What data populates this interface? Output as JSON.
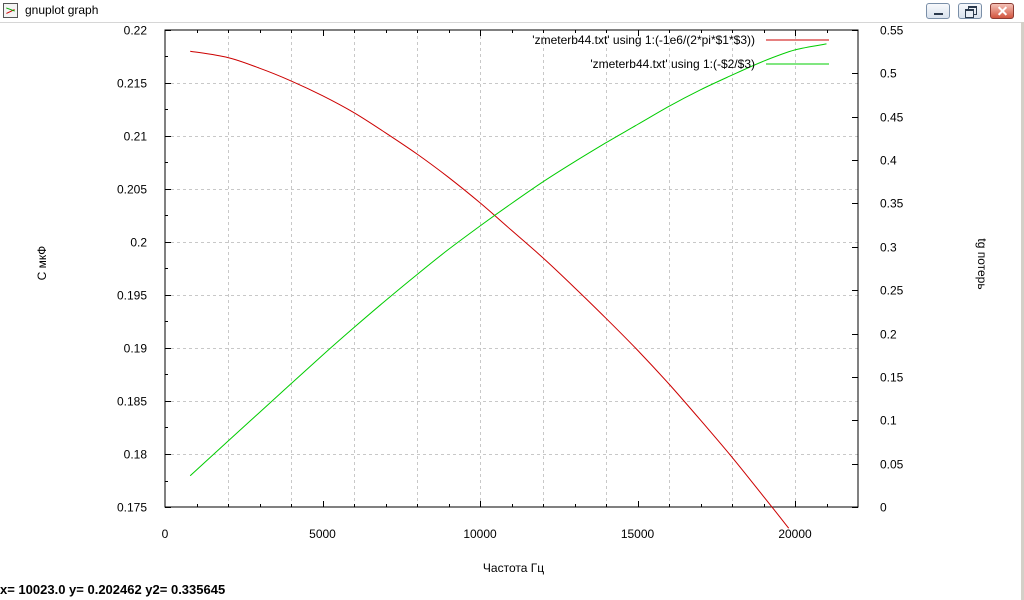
{
  "window": {
    "title": "gnuplot graph",
    "icon": "gnuplot-app-icon",
    "controls": {
      "minimize": "minimize-icon",
      "maximize": "maximize-icon",
      "close": "close-icon"
    }
  },
  "status_text": "x= 10023.0 y= 0.202462 y2= 0.335645",
  "chart_data": {
    "type": "line",
    "title": "",
    "xlabel": "Частота Гц",
    "ylabel": "С мкФ",
    "y2label": "tg потерь",
    "xlim": [
      0,
      22000
    ],
    "ylim": [
      0.175,
      0.22
    ],
    "y2lim": [
      0,
      0.55
    ],
    "grid": true,
    "grid_style": "dashed",
    "legend_position": "top-right",
    "x_ticks": [
      0,
      5000,
      10000,
      15000,
      20000
    ],
    "y_ticks": [
      0.175,
      0.18,
      0.185,
      0.19,
      0.195,
      0.2,
      0.205,
      0.21,
      0.215,
      0.22
    ],
    "y2_ticks": [
      0,
      0.05,
      0.1,
      0.15,
      0.2,
      0.25,
      0.3,
      0.35,
      0.4,
      0.45,
      0.5,
      0.55
    ],
    "x_tick_labels": [
      "0",
      "5000",
      "10000",
      "15000",
      "20000"
    ],
    "y_tick_labels": [
      "0.175",
      "0.18",
      "0.185",
      "0.19",
      "0.195",
      "0.2",
      "0.205",
      "0.21",
      "0.215",
      "0.22"
    ],
    "y2_tick_labels": [
      "0",
      "0.05",
      "0.1",
      "0.15",
      "0.2",
      "0.25",
      "0.3",
      "0.35",
      "0.4",
      "0.45",
      "0.5",
      "0.55"
    ],
    "series": [
      {
        "name": "'zmeterb44.txt' using 1:(-1e6/(2*pi*$1*$3))",
        "axis": "y",
        "color": "#cc0000",
        "x": [
          800,
          2000,
          3000,
          4000,
          5000,
          6000,
          7000,
          8000,
          9000,
          10000,
          11000,
          12000,
          13000,
          14000,
          15000,
          16000,
          17000,
          18000,
          19000,
          19800
        ],
        "y": [
          0.218,
          0.2174,
          0.2164,
          0.2152,
          0.2138,
          0.2122,
          0.2103,
          0.2083,
          0.2061,
          0.2037,
          0.2011,
          0.1985,
          0.1957,
          0.1928,
          0.1898,
          0.1866,
          0.1832,
          0.1797,
          0.176,
          0.173
        ]
      },
      {
        "name": "'zmeterb44.txt' using 1:(-$2/$3)",
        "axis": "y2",
        "color": "#00cc00",
        "x": [
          800,
          2000,
          3000,
          4000,
          5000,
          6000,
          7000,
          8000,
          9000,
          10000,
          11000,
          12000,
          13000,
          14000,
          15000,
          16000,
          17000,
          18000,
          19000,
          20000,
          21000
        ],
        "y": [
          0.036,
          0.076,
          0.109,
          0.142,
          0.175,
          0.207,
          0.238,
          0.268,
          0.297,
          0.324,
          0.35,
          0.375,
          0.398,
          0.42,
          0.441,
          0.462,
          0.481,
          0.498,
          0.514,
          0.527,
          0.534
        ]
      }
    ]
  }
}
